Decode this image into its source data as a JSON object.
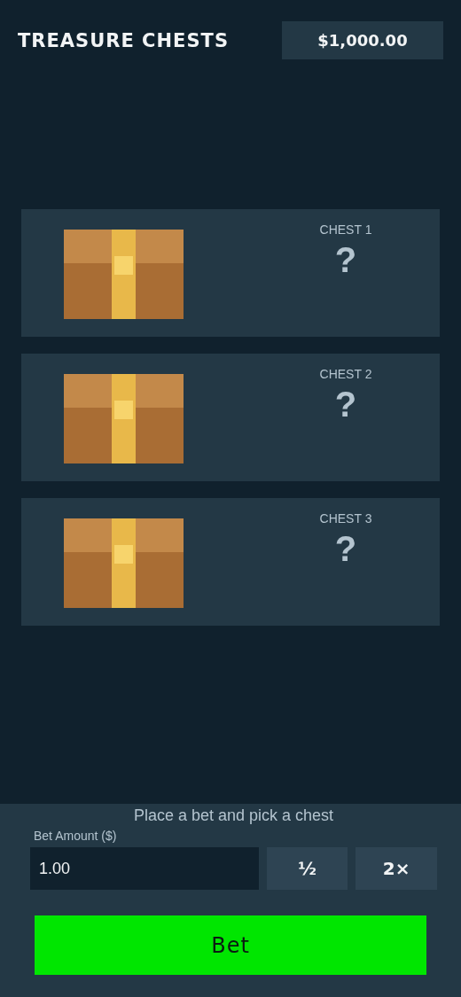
{
  "header": {
    "title": "TREASURE CHESTS",
    "balance": "$1,000.00"
  },
  "chests": [
    {
      "label": "CHEST 1",
      "result": "?"
    },
    {
      "label": "CHEST 2",
      "result": "?"
    },
    {
      "label": "CHEST 3",
      "result": "?"
    }
  ],
  "controls": {
    "status": "Place a bet and pick a chest",
    "bet_label": "Bet Amount ($)",
    "bet_value": "1.00",
    "half_button": "½",
    "double_button": "2×",
    "bet_button": "Bet"
  }
}
